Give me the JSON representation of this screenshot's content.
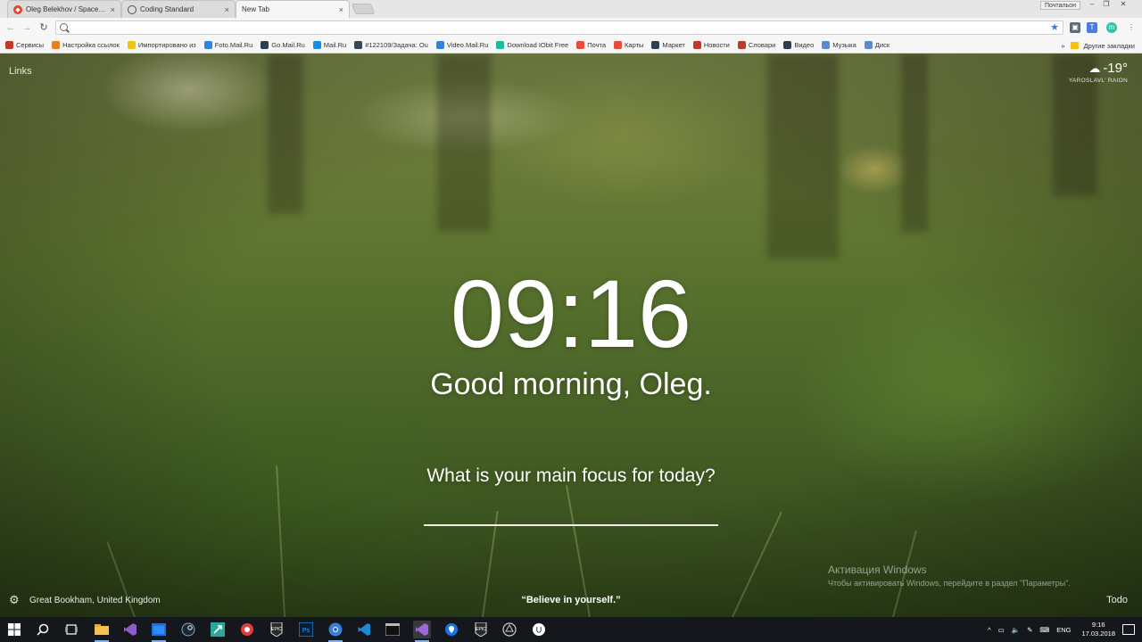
{
  "browser": {
    "tabs": [
      {
        "label": "Oleg Belekhov / SpaceBa",
        "icon": "gitlab-icon",
        "close": "×"
      },
      {
        "label": "Coding Standard",
        "icon": "globe-icon",
        "close": "×"
      },
      {
        "label": "New Tab",
        "icon": "",
        "close": "×"
      }
    ],
    "profile_label": "Почтальон",
    "address": {
      "value": "",
      "placeholder": ""
    },
    "bookmarks": [
      {
        "label": "Сервисы",
        "icon": "apps-grid-icon",
        "color": "#c0392b"
      },
      {
        "label": "Настройка ссылок",
        "icon": "windows-icon",
        "color": "#e67e22"
      },
      {
        "label": "Импортировано из",
        "icon": "folder-icon",
        "color": "#f1c40f"
      },
      {
        "label": "Foto.Mail.Ru",
        "icon": "photo-icon",
        "color": "#2e86de"
      },
      {
        "label": "Go.Mail.Ru",
        "icon": "search-icon",
        "color": "#2c3e50"
      },
      {
        "label": "Mail.Ru",
        "icon": "mailru-icon",
        "color": "#168de2"
      },
      {
        "label": "#122109/Задача: Ou",
        "icon": "task-icon",
        "color": "#34495e"
      },
      {
        "label": "Video.Mail.Ru",
        "icon": "video-icon",
        "color": "#2e86de"
      },
      {
        "label": "Download IObit Free",
        "icon": "download-icon",
        "color": "#1abc9c"
      },
      {
        "label": "Почта",
        "icon": "mail-icon",
        "color": "#e74c3c"
      },
      {
        "label": "Карты",
        "icon": "map-pin-icon",
        "color": "#e74c3c"
      },
      {
        "label": "Маркет",
        "icon": "cart-icon",
        "color": "#2c3e50"
      },
      {
        "label": "Новости",
        "icon": "news-icon",
        "color": "#c0392b"
      },
      {
        "label": "Словари",
        "icon": "dictionary-icon",
        "color": "#c0392b"
      },
      {
        "label": "Видео",
        "icon": "video-icon",
        "color": "#2c3e50"
      },
      {
        "label": "Музыка",
        "icon": "music-icon",
        "color": "#5b8bd6"
      },
      {
        "label": "Диск",
        "icon": "disk-icon",
        "color": "#5b8bd6"
      }
    ],
    "more_bookmarks": "»",
    "other_bookmarks": "Другие закладки"
  },
  "momentum": {
    "links": "Links",
    "weather": {
      "temp": "-19°",
      "location": "YAROSLAVL' RAION",
      "icon": "cloud-icon"
    },
    "clock": "09:16",
    "greeting": "Good morning, Oleg.",
    "focus_question": "What is your main focus for today?",
    "focus_value": "",
    "photo_location": "Great Bookham, United Kingdom",
    "quote": "“Believe in yourself.”",
    "todo": "Todo"
  },
  "activation": {
    "title": "Активация Windows",
    "subtitle": "Чтобы активировать Windows, перейдите в раздел \"Параметры\"."
  },
  "taskbar": {
    "lang": "ENG",
    "time": "9:16",
    "date": "17.03.2018"
  }
}
